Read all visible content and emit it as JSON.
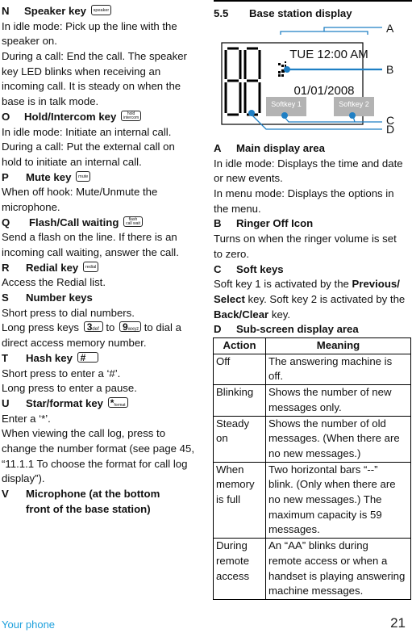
{
  "left": {
    "sections": [
      {
        "letter": "N",
        "title": "Speaker key",
        "key": "speaker",
        "lines": [
          "In idle mode: Pick up the line with the",
          "speaker on.",
          "During a call: End the call. The speaker",
          "key LED blinks when receiving an",
          "incoming call. It is steady on when the",
          "base is in talk mode."
        ]
      },
      {
        "letter": "O",
        "title": "Hold/Intercom key",
        "key_top": "hold",
        "key_bottom": "intercom",
        "lines": [
          "In idle mode: Initiate an internal call.",
          "During a call: Put the external call on",
          "hold to initiate an internal call."
        ]
      },
      {
        "letter": "P",
        "title": "Mute key",
        "key": "mute",
        "lines": [
          "When off hook: Mute/Unmute the",
          "microphone."
        ]
      },
      {
        "letter": "Q",
        "title": "Flash/Call waiting",
        "key_top": "flash",
        "key_bottom": "call wait",
        "lines": [
          "Send a flash on the line. If there is an",
          "incoming call waiting, answer the call."
        ]
      },
      {
        "letter": "R",
        "title": "Redial key",
        "key": "redial",
        "lines": [
          "Access the Redial list."
        ]
      },
      {
        "letter": "S",
        "title": "Number keys",
        "line1": "Short press to dial numbers.",
        "line2_pre": "Long press keys",
        "key_a_num": "3",
        "key_a_sub": "def",
        "line2_mid": "to",
        "key_b_num": "9",
        "key_b_sub": "wxyz",
        "line2_post": "to dial a",
        "line3": "direct access memory number."
      },
      {
        "letter": "T",
        "title": "Hash key",
        "key": "#",
        "lines": [
          "Short press to enter a ‘#’.",
          "Long press to enter a pause."
        ]
      },
      {
        "letter": "U",
        "title": "Star/format key",
        "key_main": "*",
        "key_sub": "format",
        "lines": [
          "Enter a ‘*’.",
          "When viewing the call log, press to",
          "change the number format (see page 45,",
          "“11.1.1 To choose the format for call log",
          "display”)."
        ]
      },
      {
        "letter": "V",
        "title_line1": "Microphone (at the bottom",
        "title_line2": "front of the base station)"
      }
    ]
  },
  "right": {
    "section_number": "5.5",
    "section_title": "Base station display",
    "diagram": {
      "time": "TUE 12:00 AM",
      "date": "01/01/2008",
      "softkey1": "Softkey 1",
      "softkey2": "Softkey 2",
      "segment_digits": "88",
      "callouts": [
        "A",
        "B",
        "C",
        "D"
      ],
      "accent_color": "#1f7fc4"
    },
    "items": [
      {
        "letter": "A",
        "title": "Main display area",
        "lines": [
          "In idle mode: Displays the time and date",
          "or new events.",
          "In menu mode: Displays the options in",
          "the menu."
        ]
      },
      {
        "letter": "B",
        "title": "Ringer Off Icon",
        "lines": [
          "Turns on when the ringer volume is set",
          "to zero."
        ]
      },
      {
        "letter": "C",
        "title": "Soft keys",
        "l1_pre": "Soft key 1 is activated by the ",
        "l1_bold": "Previous/",
        "l2_bold": "Select",
        "l2_post": " key. Soft key 2 is activated by the",
        "l3_bold": "Back/Clear",
        "l3_post": " key."
      },
      {
        "letter": "D",
        "title": "Sub-screen display area"
      }
    ],
    "table": {
      "headers": [
        "Action",
        "Meaning"
      ],
      "rows": [
        {
          "action": [
            "Off"
          ],
          "meaning": [
            "The answering machine is off."
          ]
        },
        {
          "action": [
            "Blinking"
          ],
          "meaning": [
            "Shows the number of new",
            "messages only."
          ]
        },
        {
          "action": [
            "Steady",
            "on"
          ],
          "meaning": [
            "Shows the number of old",
            "messages. (When there are",
            "no new messages.)"
          ]
        },
        {
          "action": [
            "When",
            "memory",
            "is full"
          ],
          "meaning": [
            "Two horizontal bars “--”",
            "blink. (Only when there are",
            "no new messages.) The",
            "maximum capacity is 59",
            "messages."
          ]
        },
        {
          "action": [
            "During",
            "remote",
            "access"
          ],
          "meaning": [
            "An “AA” blinks during",
            "remote access or when a",
            "handset is playing answering",
            "machine messages."
          ]
        }
      ]
    }
  },
  "footer": {
    "section": "Your phone",
    "page": "21",
    "section_color": "#1ea0dc"
  }
}
